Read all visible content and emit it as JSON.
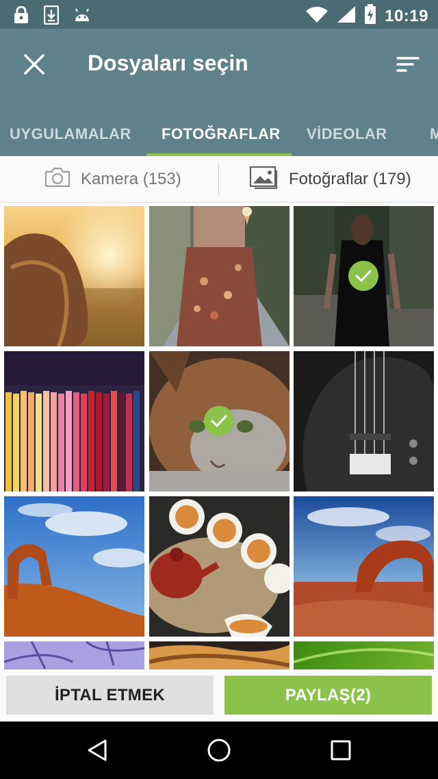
{
  "status_bar": {
    "time": "10:19",
    "icons": [
      "lock-icon",
      "download-icon",
      "android-icon",
      "wifi-icon",
      "signal-icon",
      "battery-charging-icon"
    ]
  },
  "app_bar": {
    "title": "Dosyaları seçin",
    "close_icon": "close-icon",
    "sort_icon": "sort-icon"
  },
  "tabs": [
    {
      "label": "UYGULAMALAR",
      "active": false
    },
    {
      "label": "FOTOĞRAFLAR",
      "active": true
    },
    {
      "label": "VİDEOLAR",
      "active": false
    },
    {
      "label": "M",
      "active": false
    }
  ],
  "sub_tabs": [
    {
      "label": "Kamera (153)",
      "icon": "camera-icon",
      "active": false
    },
    {
      "label": "Fotoğraflar (179)",
      "icon": "image-icon",
      "active": true
    }
  ],
  "photos": [
    {
      "subject": "girl-in-sunset-field",
      "selected": false
    },
    {
      "subject": "girl-with-ice-cream",
      "selected": false
    },
    {
      "subject": "woman-in-black-dress",
      "selected": true
    },
    {
      "subject": "colored-pencils",
      "selected": false
    },
    {
      "subject": "cat-face",
      "selected": true
    },
    {
      "subject": "bass-guitar",
      "selected": false
    },
    {
      "subject": "desert-arch",
      "selected": false
    },
    {
      "subject": "tea-set",
      "selected": false
    },
    {
      "subject": "rock-arch-landscape",
      "selected": false
    },
    {
      "subject": "purple-branches",
      "selected": false
    },
    {
      "subject": "sand-dunes",
      "selected": false
    },
    {
      "subject": "green-leaf",
      "selected": false
    }
  ],
  "actions": {
    "cancel_label": "İPTAL ETMEK",
    "share_label": "PAYLAŞ(2)"
  },
  "colors": {
    "status_bar": "#4a6a74",
    "app_bar": "#5f818c",
    "accent": "#8bc34a"
  },
  "nav_bar": [
    "back-icon",
    "home-icon",
    "recents-icon"
  ]
}
